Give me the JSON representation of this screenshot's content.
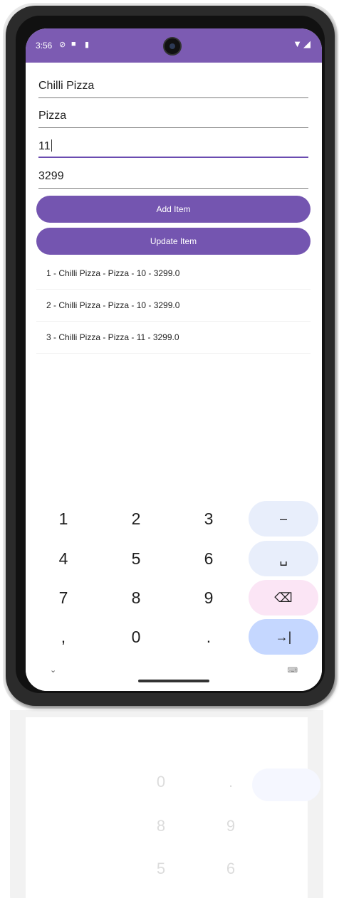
{
  "status_bar": {
    "time": "3:56",
    "icons": [
      "vpn-icon",
      "notification-icon",
      "sd-card-icon",
      "wifi-icon",
      "signal-icon"
    ]
  },
  "form": {
    "name_value": "Chilli Pizza",
    "category_value": "Pizza",
    "quantity_value": "11",
    "price_value": "3299"
  },
  "buttons": {
    "add_label": "Add Item",
    "update_label": "Update Item"
  },
  "items": [
    "1 - Chilli Pizza - Pizza - 10 - 3299.0",
    "2 - Chilli Pizza - Pizza - 10 - 3299.0",
    "3 - Chilli Pizza - Pizza - 11 - 3299.0"
  ],
  "keyboard": {
    "keys": [
      "1",
      "2",
      "3",
      "–",
      "4",
      "5",
      "6",
      "␣",
      "7",
      "8",
      "9",
      "⌫",
      ",",
      "0",
      ".",
      "→|"
    ]
  },
  "colors": {
    "accent": "#7455b0",
    "status_bar": "#7c5bb2",
    "fn_key_blue": "#e8eefb",
    "fn_key_pink": "#fbe5f5",
    "tab_key": "#c5d7ff"
  }
}
